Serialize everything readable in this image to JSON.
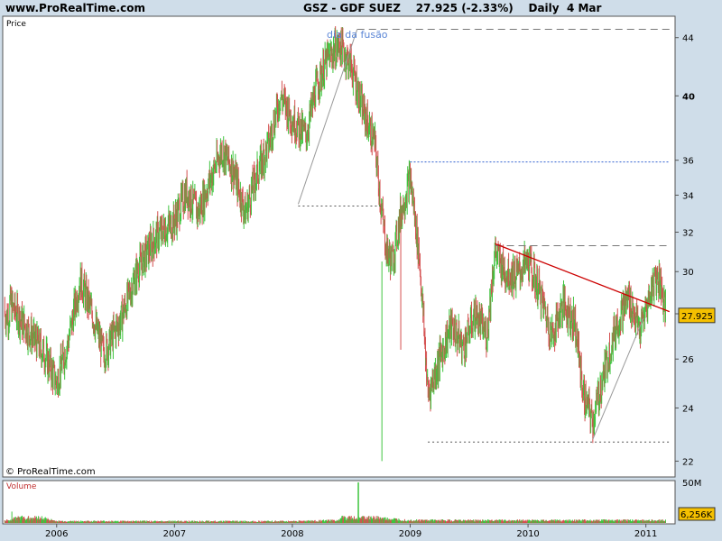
{
  "header": {
    "site": "www.ProRealTime.com",
    "title": "GSZ - GDF SUEZ    27.925 (-2.33%)    Daily  4 Mar"
  },
  "chart_data": {
    "type": "candlestick",
    "price_panel": {
      "label": "Price",
      "y_scale": "log",
      "ylim": [
        21.5,
        45.5
      ],
      "y_ticks": [
        "22",
        "24",
        "26",
        "28",
        "30",
        "32",
        "34",
        "36",
        "40",
        "44"
      ],
      "last_price_label": "27.925",
      "copyright": "© ProRealTime.com",
      "annotation": "dia da fusão",
      "up_color": "#3ec43e",
      "down_color": "#d45050",
      "series": [
        {
          "name": "",
          "x": [
            "2005.60",
            "2005.75",
            "2005.90",
            "2006.00",
            "2006.10",
            "2006.20",
            "2006.30",
            "2006.40",
            "2006.55",
            "2006.70",
            "2006.85",
            "2007.00",
            "2007.10",
            "2007.20",
            "2007.30",
            "2007.40",
            "2007.50",
            "2007.60",
            "2007.70",
            "2007.80",
            "2007.90",
            "2008.00",
            "2008.05",
            "2008.12",
            "2008.20",
            "2008.30",
            "2008.40",
            "2008.50",
            "2008.60",
            "2008.70",
            "2008.75",
            "2008.80",
            "2008.85",
            "2008.92",
            "2009.00",
            "2009.08",
            "2009.15",
            "2009.25",
            "2009.35",
            "2009.45",
            "2009.55",
            "2009.65",
            "2009.72",
            "2009.80",
            "2009.90",
            "2010.00",
            "2010.10",
            "2010.20",
            "2010.30",
            "2010.40",
            "2010.47",
            "2010.55",
            "2010.65",
            "2010.75",
            "2010.85",
            "2010.95",
            "2011.02",
            "2011.08",
            "2011.12",
            "2011.17"
          ],
          "y": [
            28.5,
            27.3,
            26.2,
            25.0,
            26.8,
            29.6,
            28.0,
            26.2,
            27.8,
            30.3,
            31.8,
            32.6,
            34.2,
            33.0,
            34.8,
            36.6,
            35.4,
            33.0,
            35.2,
            37.0,
            40.0,
            38.5,
            38.0,
            37.5,
            40.5,
            42.5,
            43.5,
            42.0,
            39.0,
            37.0,
            33.5,
            31.0,
            30.5,
            33.0,
            35.0,
            30.5,
            24.5,
            26.0,
            27.5,
            26.5,
            28.0,
            27.0,
            31.0,
            30.0,
            29.8,
            30.5,
            29.0,
            27.0,
            28.5,
            27.5,
            24.5,
            23.5,
            25.5,
            27.5,
            28.8,
            27.2,
            28.6,
            29.8,
            29.6,
            27.925
          ]
        }
      ],
      "overlays": [
        {
          "name": "",
          "type": "resistance",
          "x": [
            2009.72,
            2011.2
          ],
          "y": [
            31.3,
            31.3
          ]
        },
        {
          "name": "",
          "type": "resistance",
          "x": [
            2008.55,
            2011.2
          ],
          "y": [
            44.6,
            44.6
          ]
        },
        {
          "name": "",
          "type": "resistance",
          "x": [
            2009.0,
            2011.2
          ],
          "y": [
            35.9,
            35.9
          ]
        },
        {
          "name": "",
          "type": "support",
          "x": [
            2008.05,
            2008.75
          ],
          "y": [
            33.4,
            33.4
          ]
        },
        {
          "name": "",
          "type": "support",
          "x": [
            2009.15,
            2011.2
          ],
          "y": [
            22.7,
            22.7
          ]
        },
        {
          "name": "",
          "type": "trendline",
          "x": [
            2009.72,
            2011.2
          ],
          "y": [
            31.4,
            28.1
          ]
        },
        {
          "name": "",
          "type": "trendline",
          "x": [
            2008.05,
            2008.55
          ],
          "y": [
            33.5,
            44.6
          ]
        },
        {
          "name": "",
          "type": "trendline",
          "x": [
            2010.55,
            2010.98
          ],
          "y": [
            22.8,
            27.8
          ]
        }
      ]
    },
    "volume_panel": {
      "label": "Volume",
      "y_ticks": [
        "50M"
      ],
      "last_volume_label": "6,256K",
      "x": [
        "2005.62",
        "2006.00",
        "2006.50",
        "2007.00",
        "2007.50",
        "2008.00",
        "2008.40",
        "2008.56",
        "2008.75",
        "2009.00",
        "2009.50",
        "2010.00",
        "2010.50",
        "2011.00"
      ],
      "y": [
        14,
        2,
        2,
        2,
        2,
        2,
        3,
        50,
        5,
        3,
        3,
        3,
        3,
        3
      ]
    },
    "x_ticks": [
      "2006",
      "2007",
      "2008",
      "2009",
      "2010",
      "2011"
    ]
  }
}
